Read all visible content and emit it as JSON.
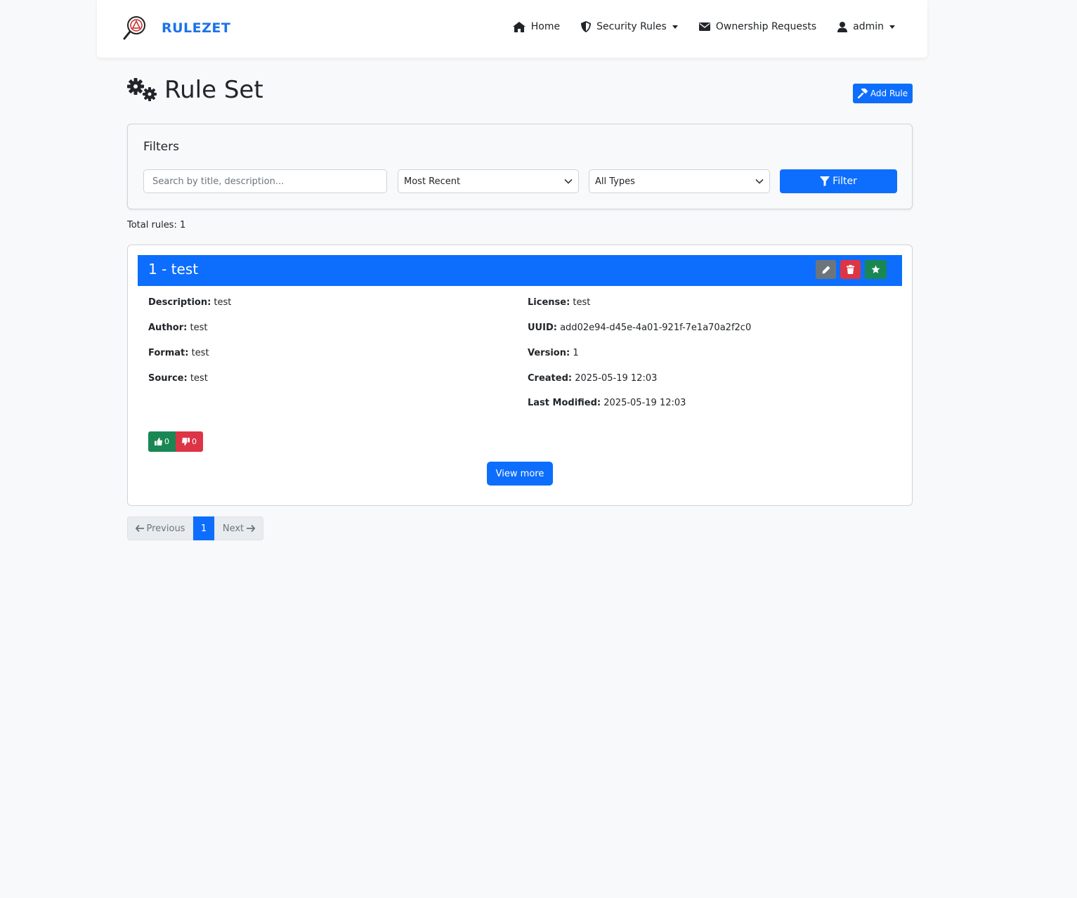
{
  "navbar": {
    "brand": "RULEZET",
    "items": [
      {
        "label": "Home",
        "icon": "home-icon"
      },
      {
        "label": "Security Rules",
        "icon": "shield-icon"
      },
      {
        "label": "Ownership Requests",
        "icon": "envelope-icon"
      },
      {
        "label": "admin",
        "icon": "user-icon"
      }
    ]
  },
  "page": {
    "title": "Rule Set",
    "add_rule_label": "Add Rule"
  },
  "filters": {
    "title": "Filters",
    "search_placeholder": "Search by title, description...",
    "sort_value": "Most Recent",
    "type_value": "All Types",
    "filter_label": "Filter"
  },
  "total_rules": "Total rules: 1",
  "rule": {
    "title": "1 - test",
    "left_fields": [
      {
        "label": "Description:",
        "value": "test"
      },
      {
        "label": "Author:",
        "value": "test"
      },
      {
        "label": "Format:",
        "value": "test"
      },
      {
        "label": "Source:",
        "value": "test"
      }
    ],
    "right_fields": [
      {
        "label": "License:",
        "value": "test"
      },
      {
        "label": "UUID:",
        "value": "add02e94-d45e-4a01-921f-7e1a70a2f2c0"
      },
      {
        "label": "Version:",
        "value": "1"
      },
      {
        "label": "Created:",
        "value": "2025-05-19 12:03"
      },
      {
        "label": "Last Modified:",
        "value": "2025-05-19 12:03"
      }
    ],
    "upvotes": "0",
    "downvotes": "0",
    "view_more_label": "View more"
  },
  "pagination": {
    "previous": "Previous",
    "current": "1",
    "next": "Next"
  },
  "colors": {
    "primary": "#0d6efd",
    "brand": "#1a73e8",
    "success": "#198754",
    "danger": "#dc3545",
    "secondary": "#6c757d"
  }
}
